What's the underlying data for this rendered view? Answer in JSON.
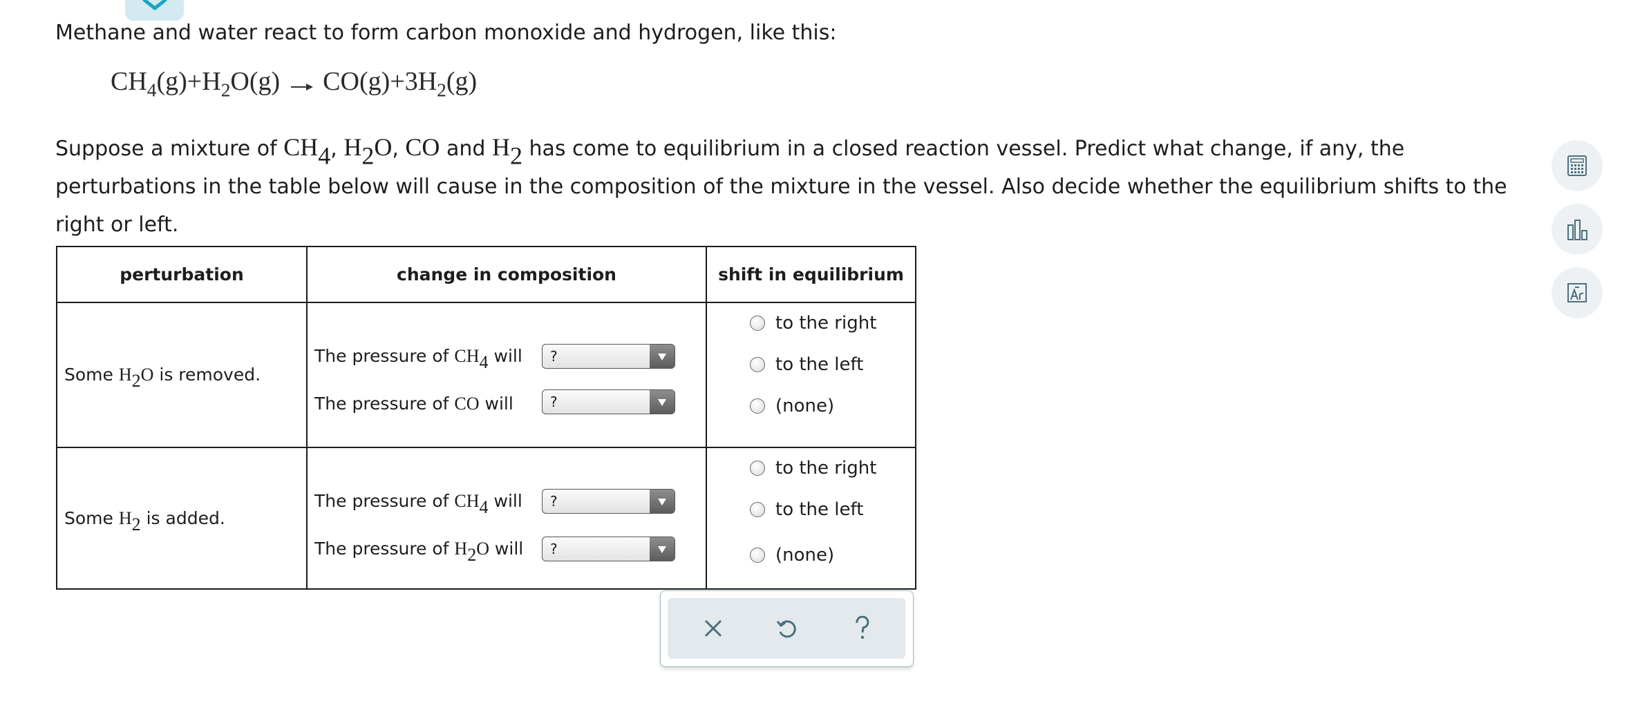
{
  "intro_text": "Methane and water react to form carbon monoxide and hydrogen, like this:",
  "equation": {
    "reactant1": "CH",
    "reactant1_sub": "4",
    "reactant1_state": "(g)",
    "plus1": "+",
    "reactant2_a": "H",
    "reactant2_sub": "2",
    "reactant2_b": "O",
    "reactant2_state": "(g)",
    "product1": "CO",
    "product1_state": "(g)",
    "plus2": "+",
    "product2_coef": "3",
    "product2": "H",
    "product2_sub": "2",
    "product2_state": "(g)"
  },
  "question": {
    "part1": "Suppose a mixture of ",
    "ch4": "CH",
    "ch4_sub": "4",
    "comma1": ", ",
    "h2o_a": "H",
    "h2o_sub": "2",
    "h2o_b": "O",
    "comma2": ", ",
    "co": "CO",
    "and_text": " and ",
    "h2": "H",
    "h2_sub": "2",
    "part2": " has come to equilibrium in a closed reaction vessel. Predict what change, if any, the perturbations in the table below will cause in the composition of the mixture in the vessel. Also decide whether the equilibrium shifts to the right or left."
  },
  "table": {
    "headers": [
      "perturbation",
      "change in composition",
      "shift in equilibrium"
    ],
    "rows": [
      {
        "perturbation": {
          "pre": "Some ",
          "species_a": "H",
          "species_sub": "2",
          "species_b": "O",
          "post": " is removed."
        },
        "changes": [
          {
            "pre": "The pressure of ",
            "species_a": "CH",
            "species_sub": "4",
            "species_b": "",
            "post": " will",
            "selected": "?"
          },
          {
            "pre": "The pressure of ",
            "species_a": "CO",
            "species_sub": "",
            "species_b": "",
            "post": " will",
            "selected": "?"
          }
        ],
        "options": [
          "to the right",
          "to the left",
          "(none)"
        ]
      },
      {
        "perturbation": {
          "pre": "Some ",
          "species_a": "H",
          "species_sub": "2",
          "species_b": "",
          "post": " is added."
        },
        "changes": [
          {
            "pre": "The pressure of ",
            "species_a": "CH",
            "species_sub": "4",
            "species_b": "",
            "post": " will",
            "selected": "?"
          },
          {
            "pre": "The pressure of ",
            "species_a": "H",
            "species_sub": "2",
            "species_b": "O",
            "post": " will",
            "selected": "?"
          }
        ],
        "options": [
          "to the right",
          "to the left",
          "(none)"
        ]
      }
    ]
  },
  "actions": {
    "clear": "×",
    "help": "?"
  },
  "tools": [
    "calculator-icon",
    "bar-chart-icon",
    "periodic-table-icon"
  ],
  "colors": {
    "accent": "#1aa5c4",
    "tab_bg": "#d3eaf0",
    "action_bg": "#e3e9ed",
    "tool_bg": "#eef1f3"
  }
}
